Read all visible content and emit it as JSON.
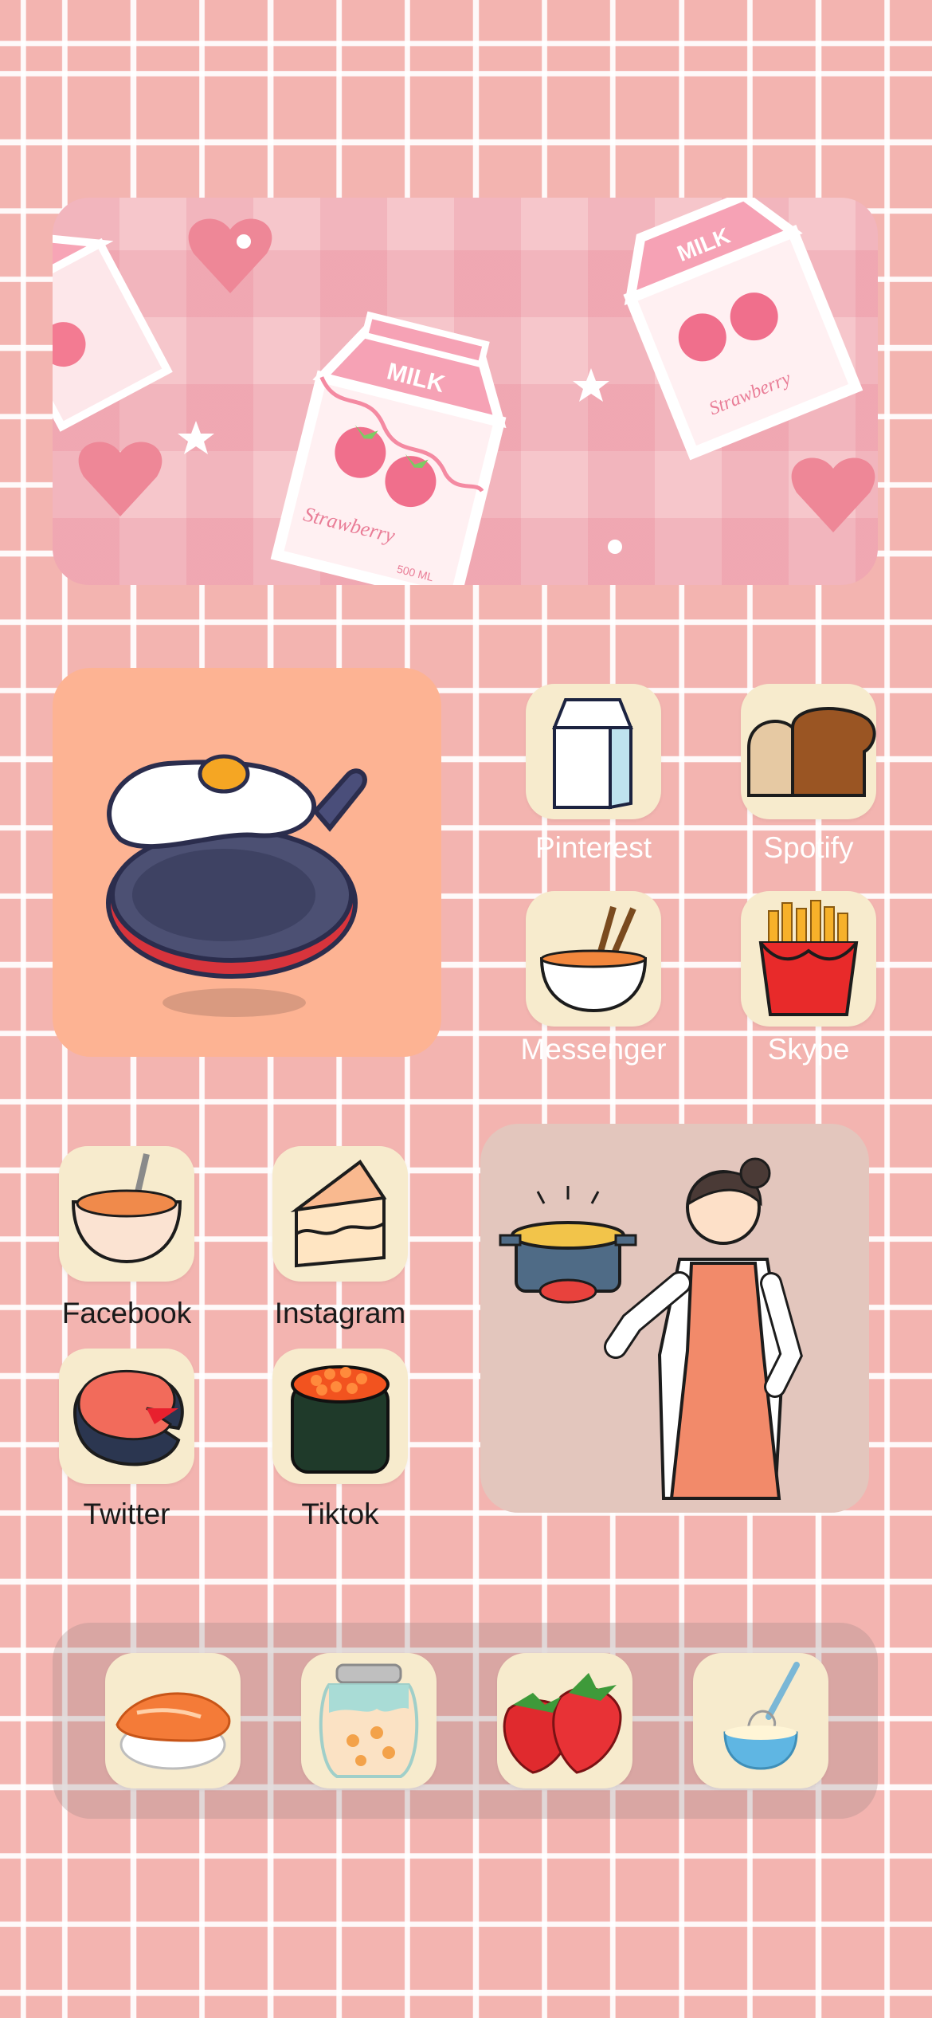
{
  "apps": {
    "pinterest": {
      "label": "Pinterest",
      "icon": "milk-carton-icon"
    },
    "spotify": {
      "label": "Spotify",
      "icon": "bread-loaf-icon"
    },
    "messenger": {
      "label": "Messenger",
      "icon": "noodle-bowl-icon"
    },
    "skype": {
      "label": "Skype",
      "icon": "french-fries-icon"
    },
    "facebook": {
      "label": "Facebook",
      "icon": "soup-bowl-icon"
    },
    "instagram": {
      "label": "Instagram",
      "icon": "cake-slice-icon"
    },
    "twitter": {
      "label": "Twitter",
      "icon": "salmon-steak-icon"
    },
    "tiktok": {
      "label": "Tiktok",
      "icon": "sushi-roll-icon"
    }
  },
  "banner": {
    "milk_text": "MILK",
    "flavor_text": "Strawberry",
    "volume_text": "500 ML"
  },
  "dock": {
    "items": [
      "nigiri-sushi-icon",
      "honey-jar-icon",
      "strawberries-icon",
      "whisk-bowl-icon"
    ]
  },
  "colors": {
    "background": "#f3b4b0",
    "icon_tile": "#f7ebcd",
    "pan_widget": "#fdb393",
    "chef_widget": "#e3c6bd"
  }
}
